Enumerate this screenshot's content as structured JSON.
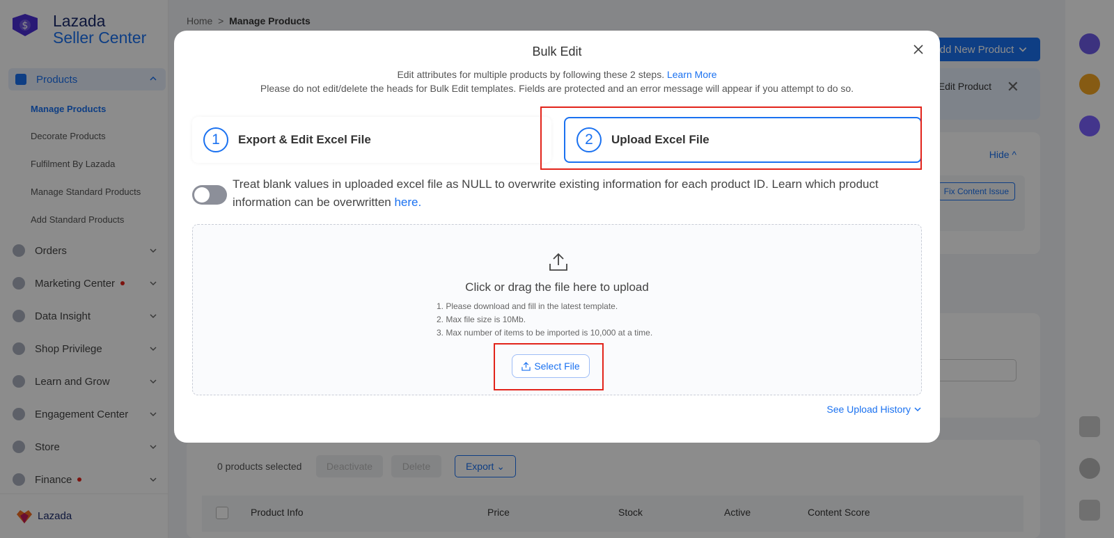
{
  "brand": {
    "line1": "Lazada",
    "line2": "Seller Center",
    "footer": "Lazada"
  },
  "sidebar": {
    "products": "Products",
    "sub_items": [
      "Manage Products",
      "Decorate Products",
      "Fulfilment By Lazada",
      "Manage Standard Products",
      "Add Standard Products"
    ],
    "items": [
      "Orders",
      "Marketing Center",
      "Data Insight",
      "Shop Privilege",
      "Learn and Grow",
      "Engagement Center",
      "Store",
      "Finance"
    ]
  },
  "breadcrumb": {
    "home": "Home",
    "sep": ">",
    "current": "Manage Products"
  },
  "header": {
    "add_button": "Add New Product"
  },
  "notice": {
    "text": "d, Edit Product"
  },
  "card1": {
    "hide": "Hide",
    "fix": "Fix Content Issue"
  },
  "bulk_bar": {
    "selected": "0 products selected",
    "deactivate": "Deactivate",
    "delete": "Delete",
    "export": "Export"
  },
  "table": {
    "columns": [
      "Product Info",
      "Price",
      "Stock",
      "Active",
      "Content Score"
    ]
  },
  "modal": {
    "title": "Bulk Edit",
    "subtitle1": "Edit attributes for multiple products by following these 2 steps.",
    "learn_more": "Learn More",
    "subtitle2": "Please do not edit/delete the heads for Bulk Edit templates. Fields are protected and an error message will appear if you attempt to do so.",
    "steps": [
      {
        "num": "1",
        "label": "Export & Edit Excel File"
      },
      {
        "num": "2",
        "label": "Upload Excel File"
      }
    ],
    "toggle_text": "Treat blank values in uploaded excel file as NULL to overwrite existing information for each product ID. Learn which product information can be overwritten",
    "toggle_link": "here.",
    "upload": {
      "title": "Click or drag the file here to upload",
      "tips": [
        "1. Please download and fill in the latest template.",
        "2. Max file size is 10Mb.",
        "3. Max number of items to be imported is 10,000 at a time."
      ],
      "button": "Select File"
    },
    "history": "See Upload History"
  },
  "colors": {
    "accent": "#1a71f0",
    "highlight": "#e2231a"
  }
}
